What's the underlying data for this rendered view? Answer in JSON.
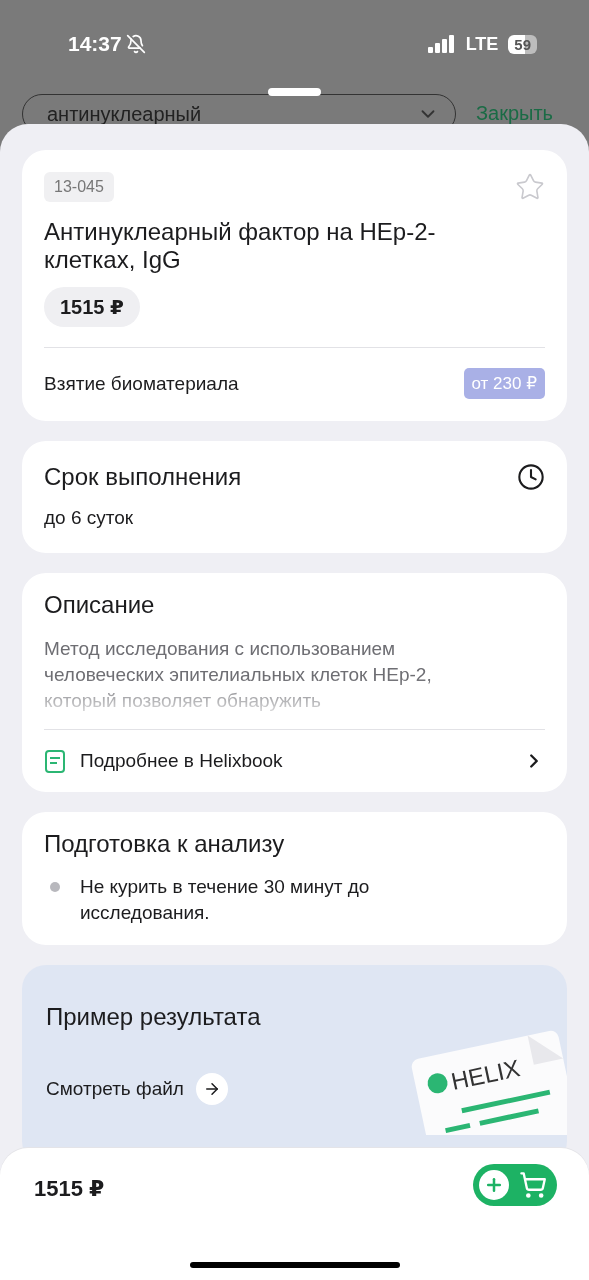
{
  "status_bar": {
    "time": "14:37",
    "network": "LTE",
    "battery": "59"
  },
  "background": {
    "search_value": "антинуклеарный",
    "close_link": "Закрыть"
  },
  "test": {
    "code": "13-045",
    "favorite": false,
    "title": "Антинуклеарный фактор на HEp-2-клетках, IgG",
    "price": "1515 ₽",
    "sampling_label": "Взятие биоматериала",
    "sampling_price": "от 230 ₽"
  },
  "duration": {
    "title": "Срок выполнения",
    "value": "до 6 суток"
  },
  "description": {
    "title": "Описание",
    "lines": [
      "Метод исследования с использованием",
      "человеческих эпителиальных клеток HEp-2,",
      "который позволяет обнаружить"
    ],
    "link": "Подробнее в Helixbook"
  },
  "preparation": {
    "title": "Подготовка к анализу",
    "items": [
      "Не курить в течение 30 минут до исследования."
    ]
  },
  "result_example": {
    "title": "Пример результата",
    "link": "Смотреть файл",
    "illustration_label": "HELIX"
  },
  "bottom_bar": {
    "price": "1515 ₽"
  }
}
